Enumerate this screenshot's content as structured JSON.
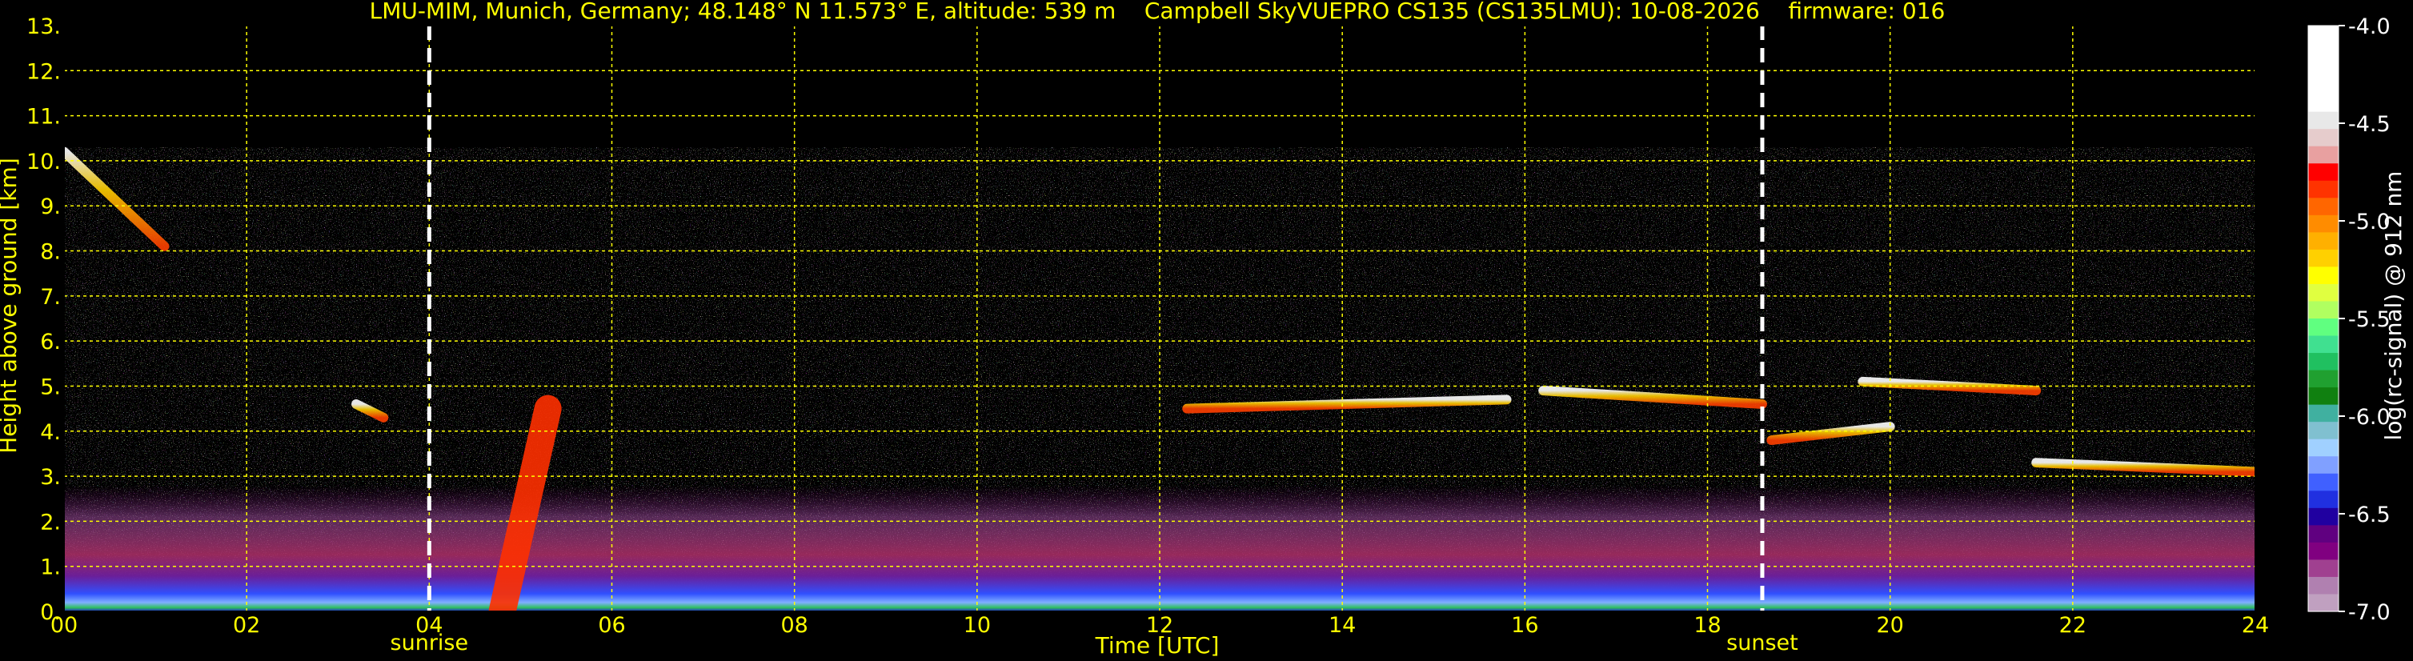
{
  "chart_data": {
    "type": "heatmap",
    "title": "LMU-MIM, Munich, Germany; 48.148° N 11.573° E, altitude: 539 m    Campbell SkyVUEPRO CS135 (CS135LMU): 10-08-2026    firmware: 016",
    "xlabel": "Time [UTC]",
    "ylabel": "Height above ground [km]",
    "xlim": [
      0,
      24
    ],
    "ylim": [
      0,
      13
    ],
    "x_ticks": [
      "00",
      "02",
      "04",
      "06",
      "08",
      "10",
      "12",
      "14",
      "16",
      "18",
      "20",
      "22",
      "24"
    ],
    "y_ticks": [
      "0.",
      "1.",
      "2.",
      "3.",
      "4.",
      "5.",
      "6.",
      "7.",
      "8.",
      "9.",
      "10.",
      "11.",
      "12.",
      "13."
    ],
    "grid": true,
    "grid_color": "#ffff00",
    "annotations": [
      {
        "label": "sunrise",
        "x": 4.0
      },
      {
        "label": "sunset",
        "x": 18.6
      }
    ],
    "data_top_km": 10.3,
    "boundary_layer_top_km": 2.8,
    "cloud_layers": [
      {
        "x_start": 0.0,
        "x_end": 1.1,
        "y_start": 10.2,
        "y_end": 8.1
      },
      {
        "x_start": 3.2,
        "x_end": 3.5,
        "y_start": 4.6,
        "y_end": 4.3
      },
      {
        "x_start": 4.8,
        "x_end": 5.3,
        "y_start": 0.0,
        "y_end": 4.5
      },
      {
        "x_start": 12.3,
        "x_end": 15.8,
        "y_start": 4.5,
        "y_end": 4.7
      },
      {
        "x_start": 16.2,
        "x_end": 18.6,
        "y_start": 4.9,
        "y_end": 4.6
      },
      {
        "x_start": 18.7,
        "x_end": 20.0,
        "y_start": 3.8,
        "y_end": 4.1
      },
      {
        "x_start": 19.7,
        "x_end": 21.6,
        "y_start": 5.1,
        "y_end": 4.9
      },
      {
        "x_start": 21.6,
        "x_end": 24.0,
        "y_start": 3.3,
        "y_end": 3.1
      }
    ],
    "colorbar": {
      "label": "log(rc-signal) @ 912 nm",
      "min": -7.0,
      "max": -4.0,
      "ticks": [
        "-4.0",
        "-4.5",
        "-5.0",
        "-5.5",
        "-6.0",
        "-6.5",
        "-7.0"
      ],
      "colors": [
        "#ffffff",
        "#ffffff",
        "#ffffff",
        "#ffffff",
        "#ffffff",
        "#e8e8e8",
        "#e6cccc",
        "#e8a0a0",
        "#ff0000",
        "#ff3300",
        "#ff6600",
        "#ff8c00",
        "#ffb000",
        "#ffd000",
        "#ffff00",
        "#e0ff40",
        "#b0ff60",
        "#60ff80",
        "#40e090",
        "#20c060",
        "#20a030",
        "#108010",
        "#40b0a0",
        "#80c0d0",
        "#a0d0ff",
        "#80a0ff",
        "#4060ff",
        "#2030e0",
        "#2000a0",
        "#600080",
        "#800080",
        "#a04090",
        "#b080b0",
        "#c0a0c0"
      ]
    }
  }
}
